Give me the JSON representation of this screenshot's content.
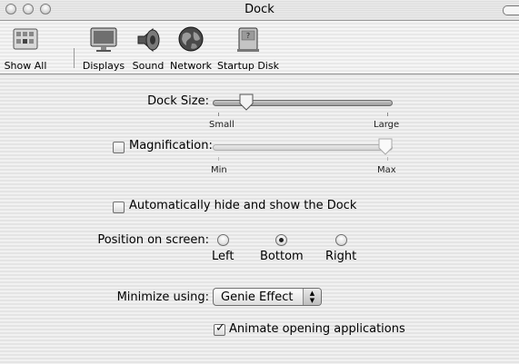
{
  "window": {
    "title": "Dock"
  },
  "toolbar": {
    "items": [
      {
        "label": "Show All"
      },
      {
        "label": "Displays"
      },
      {
        "label": "Sound"
      },
      {
        "label": "Network"
      },
      {
        "label": "Startup Disk"
      }
    ]
  },
  "dock_size": {
    "label": "Dock Size:",
    "min_label": "Small",
    "max_label": "Large",
    "value_fraction": 0.2
  },
  "magnification": {
    "label": "Magnification:",
    "checked": false,
    "min_label": "Min",
    "max_label": "Max",
    "value_fraction": 1.0
  },
  "autohide": {
    "label": "Automatically hide and show the Dock",
    "checked": false
  },
  "position": {
    "label": "Position on screen:",
    "options": [
      {
        "label": "Left",
        "selected": false
      },
      {
        "label": "Bottom",
        "selected": true
      },
      {
        "label": "Right",
        "selected": false
      }
    ]
  },
  "minimize": {
    "label": "Minimize using:",
    "selected": "Genie Effect",
    "arrow_glyph": "▲▼"
  },
  "animate": {
    "label": "Animate opening applications",
    "checked": true,
    "check_glyph": "✓"
  }
}
